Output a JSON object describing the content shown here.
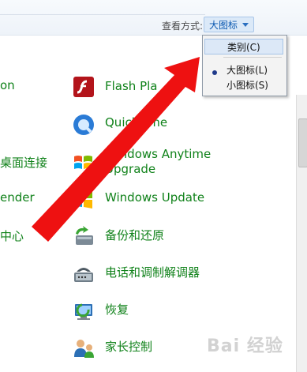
{
  "toolbar": {
    "view_by_label": "查看方式:",
    "view_by_value": "大图标"
  },
  "dropdown": {
    "options": [
      {
        "label": "类别(C)",
        "highlighted": true
      },
      {
        "label": "大图标(L)",
        "selected": true
      },
      {
        "label": "小图标(S)"
      }
    ]
  },
  "left_column": {
    "items": [
      "on",
      "桌面连接",
      "ender",
      "中心"
    ]
  },
  "items": [
    {
      "label": "Flash Pla",
      "icon": "flash-icon"
    },
    {
      "label": "QuickTime",
      "icon": "quicktime-icon"
    },
    {
      "label": "Windows Anytime",
      "label2": "Upgrade",
      "icon": "windows-anytime-icon"
    },
    {
      "label": "Windows Update",
      "icon": "windows-update-icon"
    },
    {
      "label": "备份和还原",
      "icon": "backup-icon"
    },
    {
      "label": "电话和调制解调器",
      "icon": "phone-modem-icon"
    },
    {
      "label": "恢复",
      "icon": "recovery-icon"
    },
    {
      "label": "家长控制",
      "icon": "parental-control-icon"
    }
  ],
  "watermark": "Bai 经验"
}
